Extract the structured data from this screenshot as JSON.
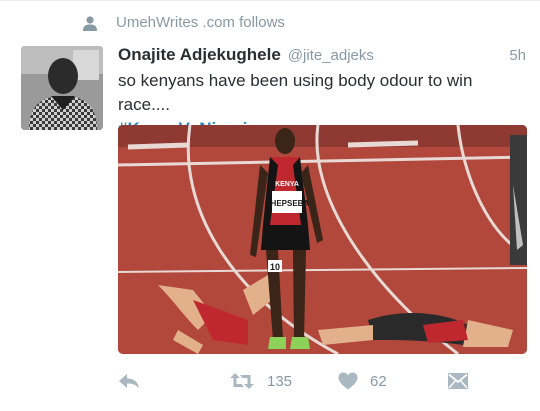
{
  "social_context": {
    "icon": "person-icon",
    "text": "UmehWrites .com follows"
  },
  "tweet": {
    "author_name": "Onajite Adjekughele",
    "author_handle": "@jite_adjeks",
    "time": "5h",
    "text": "so kenyans have been using body odour to win race....",
    "hashtag": "#KenyaVsNigeria",
    "media": {
      "bib_country": "KENYA",
      "bib_name": "CHEPSEBA",
      "lane_number": "10"
    }
  },
  "actions": {
    "reply_icon": "reply-icon",
    "retweet_icon": "retweet-icon",
    "retweet_count": "135",
    "like_icon": "heart-icon",
    "like_count": "62",
    "dm_icon": "direct-message-icon"
  },
  "colors": {
    "text": "#292f33",
    "muted": "#8899a6",
    "link": "#2a84c7",
    "track": "#b2473c"
  }
}
